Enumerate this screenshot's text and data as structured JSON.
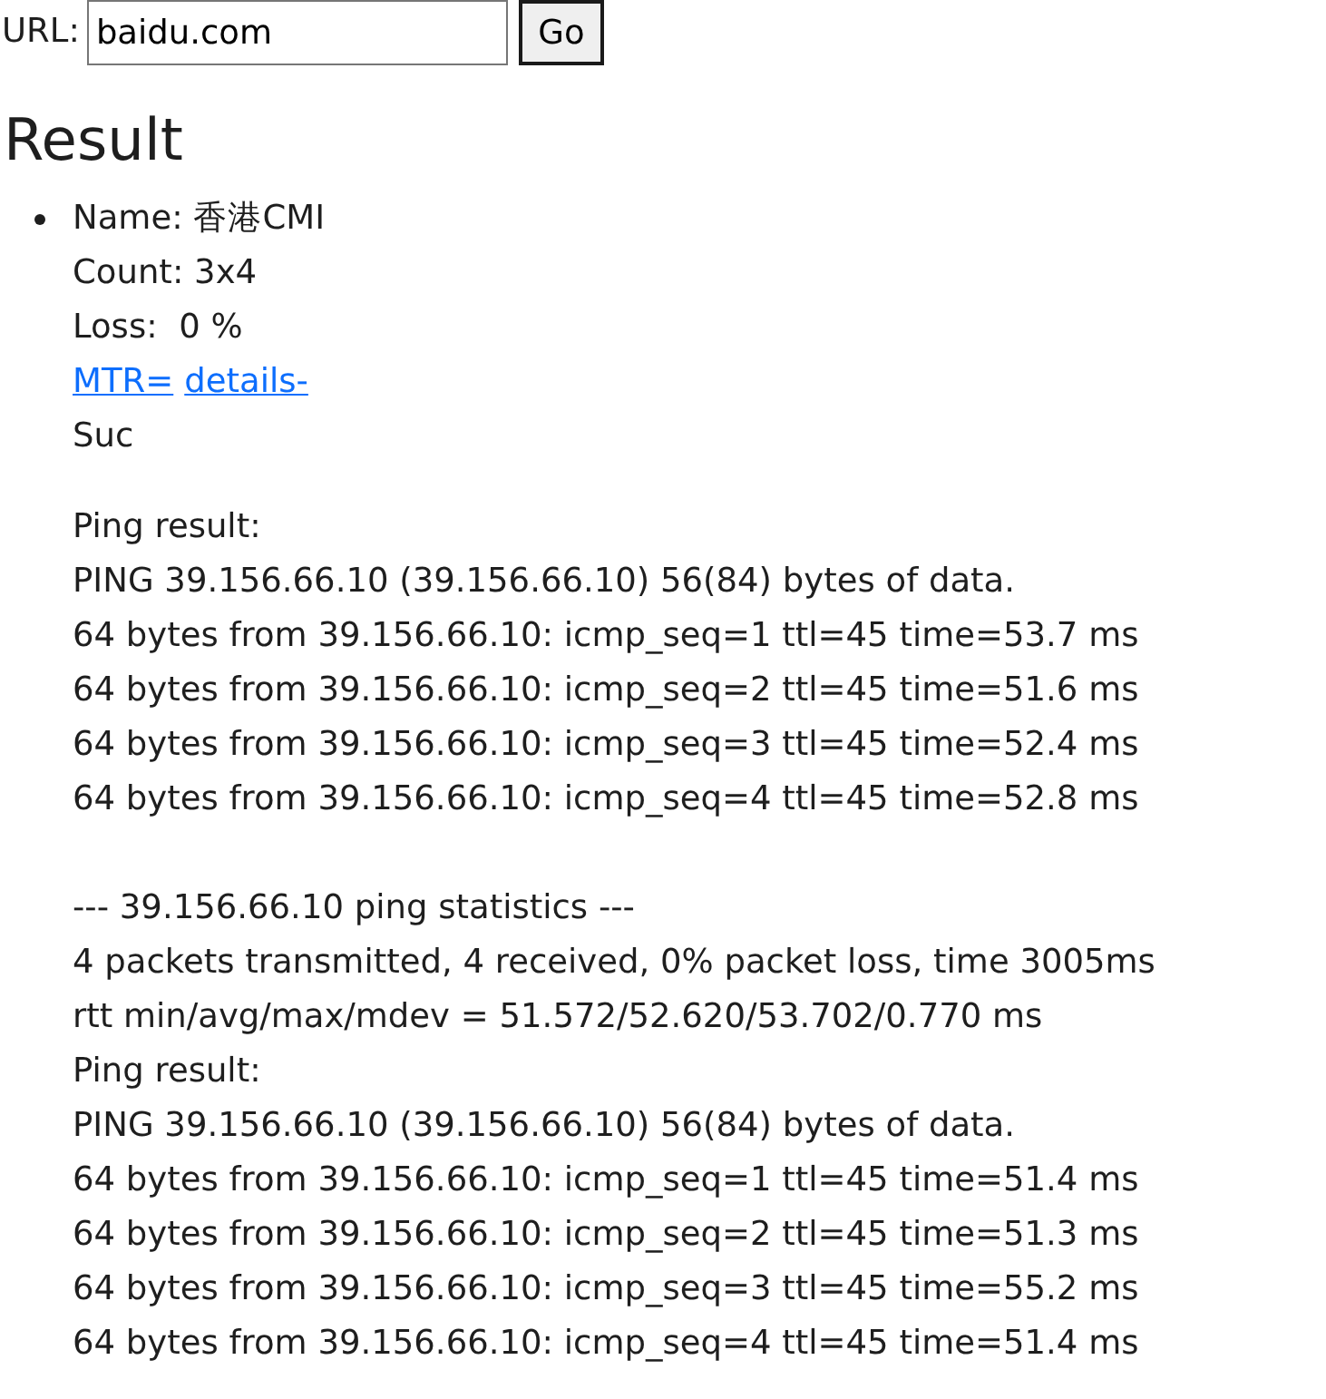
{
  "url_bar": {
    "label": "URL:",
    "value": "baidu.com",
    "button": "Go"
  },
  "heading": "Result",
  "results": [
    {
      "name": "Name: 香港CMI",
      "count": "Count: 3x4",
      "loss": "Loss:  0 %",
      "links": [
        "MTR=",
        "details-"
      ],
      "status": "Suc",
      "ping_blocks": [
        {
          "title": "Ping result:",
          "header": "PING 39.156.66.10 (39.156.66.10) 56(84) bytes of data.",
          "replies": [
            "64 bytes from 39.156.66.10: icmp_seq=1 ttl=45 time=53.7 ms",
            "64 bytes from 39.156.66.10: icmp_seq=2 ttl=45 time=51.6 ms",
            "64 bytes from 39.156.66.10: icmp_seq=3 ttl=45 time=52.4 ms",
            "64 bytes from 39.156.66.10: icmp_seq=4 ttl=45 time=52.8 ms"
          ],
          "statistics": [
            "--- 39.156.66.10 ping statistics ---",
            "4 packets transmitted, 4 received, 0% packet loss, time 3005ms",
            "rtt min/avg/max/mdev = 51.572/52.620/53.702/0.770 ms"
          ]
        },
        {
          "title": "Ping result:",
          "header": "PING 39.156.66.10 (39.156.66.10) 56(84) bytes of data.",
          "replies": [
            "64 bytes from 39.156.66.10: icmp_seq=1 ttl=45 time=51.4 ms",
            "64 bytes from 39.156.66.10: icmp_seq=2 ttl=45 time=51.3 ms",
            "64 bytes from 39.156.66.10: icmp_seq=3 ttl=45 time=55.2 ms",
            "64 bytes from 39.156.66.10: icmp_seq=4 ttl=45 time=51.4 ms"
          ]
        }
      ]
    }
  ]
}
